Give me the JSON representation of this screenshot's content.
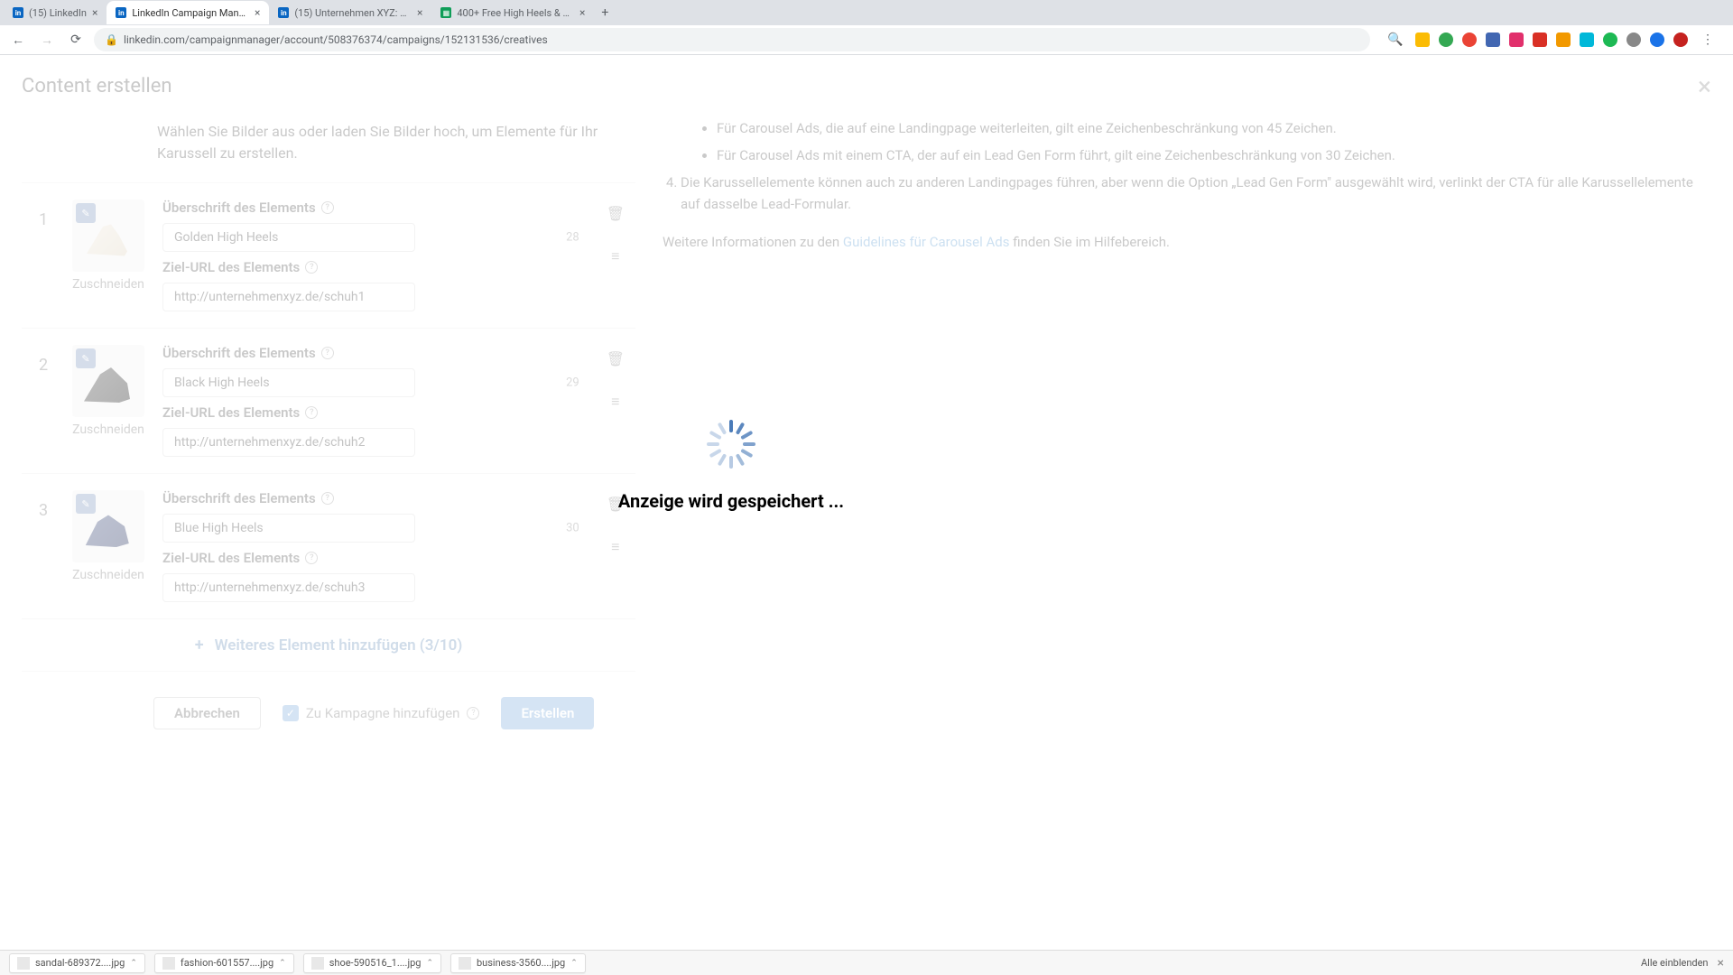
{
  "browser": {
    "tabs": [
      {
        "title": "(15) LinkedIn",
        "active": false
      },
      {
        "title": "LinkedIn Campaign Manager",
        "active": true
      },
      {
        "title": "(15) Unternehmen XYZ: Admin",
        "active": false
      },
      {
        "title": "400+ Free High Heels & Shoe",
        "active": false
      }
    ],
    "url": "linkedin.com/campaignmanager/account/508376374/campaigns/152131536/creatives"
  },
  "header": {
    "title": "Content erstellen"
  },
  "intro": "Wählen Sie Bilder aus oder laden Sie Bilder hoch, um Elemente für Ihr Karussell zu erstellen.",
  "labels": {
    "headline": "Überschrift des Elements",
    "url": "Ziel-URL des Elements",
    "crop": "Zuschneiden"
  },
  "cards": [
    {
      "num": "1",
      "headline": "Golden High Heels",
      "count": "28",
      "url": "http://unternehmenxyz.de/schuh1"
    },
    {
      "num": "2",
      "headline": "Black High Heels",
      "count": "29",
      "url": "http://unternehmenxyz.de/schuh2"
    },
    {
      "num": "3",
      "headline": "Blue High Heels",
      "count": "30",
      "url": "http://unternehmenxyz.de/schuh3"
    }
  ],
  "add_more": "Weiteres Element hinzufügen (3/10)",
  "info": {
    "bullet1": "Für Carousel Ads, die auf eine Landingpage weiterleiten, gilt eine Zeichenbeschränkung von 45 Zeichen.",
    "bullet2": "Für Carousel Ads mit einem CTA, der auf ein Lead Gen Form führt, gilt eine Zeichenbeschränkung von 30 Zeichen.",
    "ordered4": "Die Karussellelemente können auch zu anderen Landingpages führen, aber wenn die Option „Lead Gen Form\" ausgewählt wird, verlinkt der CTA für alle Karussellelemente auf dasselbe Lead-Formular.",
    "more_pre": "Weitere Informationen zu den ",
    "more_link": "Guidelines für Carousel Ads",
    "more_post": " finden Sie im Hilfebereich."
  },
  "footer": {
    "cancel": "Abbrechen",
    "checkbox": "Zu Kampagne hinzufügen",
    "create": "Erstellen"
  },
  "loading": "Anzeige wird gespeichert ...",
  "downloads": {
    "items": [
      "sandal-689372....jpg",
      "fashion-601557....jpg",
      "shoe-590516_1....jpg",
      "business-3560....jpg"
    ],
    "show_all": "Alle einblenden"
  }
}
